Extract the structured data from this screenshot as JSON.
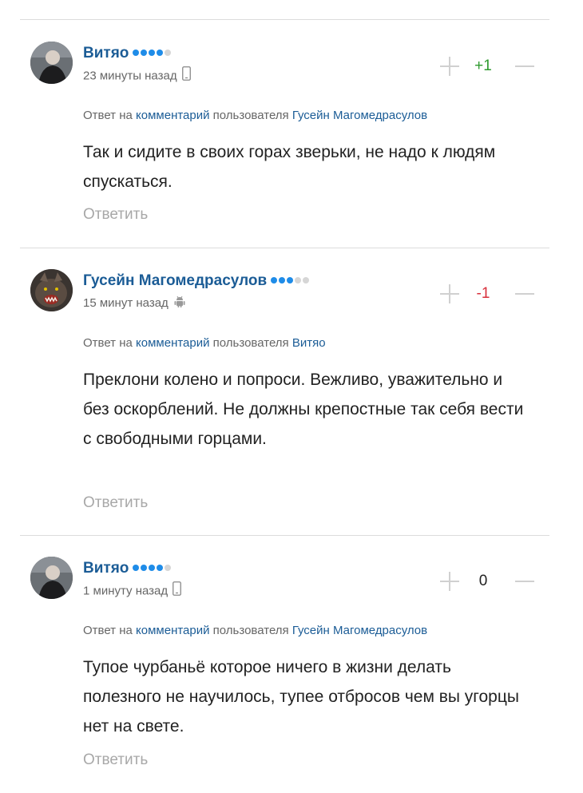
{
  "comments": [
    {
      "author": "Витяо",
      "rating_dots": 4,
      "time": "23 минуты назад",
      "device_icon": "mobile-phone-icon",
      "score": "+1",
      "score_color": "#2e9a2e",
      "reply_prefix": "Ответ на",
      "reply_link": "комментарий",
      "reply_middle": "пользователя",
      "reply_user": "Гусейн Магомедрасулов",
      "text": "Так и сидите в своих горах зверьки, не надо к людям спускаться.",
      "reply_label": "Ответить"
    },
    {
      "author": "Гусейн Магомедрасулов",
      "rating_dots": 3,
      "time": "15 минут назад",
      "device_icon": "android-icon",
      "score": "-1",
      "score_color": "#d8303c",
      "reply_prefix": "Ответ на",
      "reply_link": "комментарий",
      "reply_middle": "пользователя",
      "reply_user": "Витяо",
      "text": "Преклони колено и попроси. Вежливо, уважительно и без оскорблений. Не должны крепостные так себя вести с свободными горцами.",
      "reply_label": "Ответить"
    },
    {
      "author": "Витяо",
      "rating_dots": 4,
      "time": "1 минуту назад",
      "device_icon": "mobile-phone-icon",
      "score": "0",
      "score_color": "#222222",
      "reply_prefix": "Ответ на",
      "reply_link": "комментарий",
      "reply_middle": "пользователя",
      "reply_user": "Гусейн Магомедрасулов",
      "text": "Тупое чурбаньё которое ничего в жизни делать полезного не научилось, тупее отбросов чем вы угорцы нет на свете.",
      "reply_label": "Ответить"
    }
  ]
}
